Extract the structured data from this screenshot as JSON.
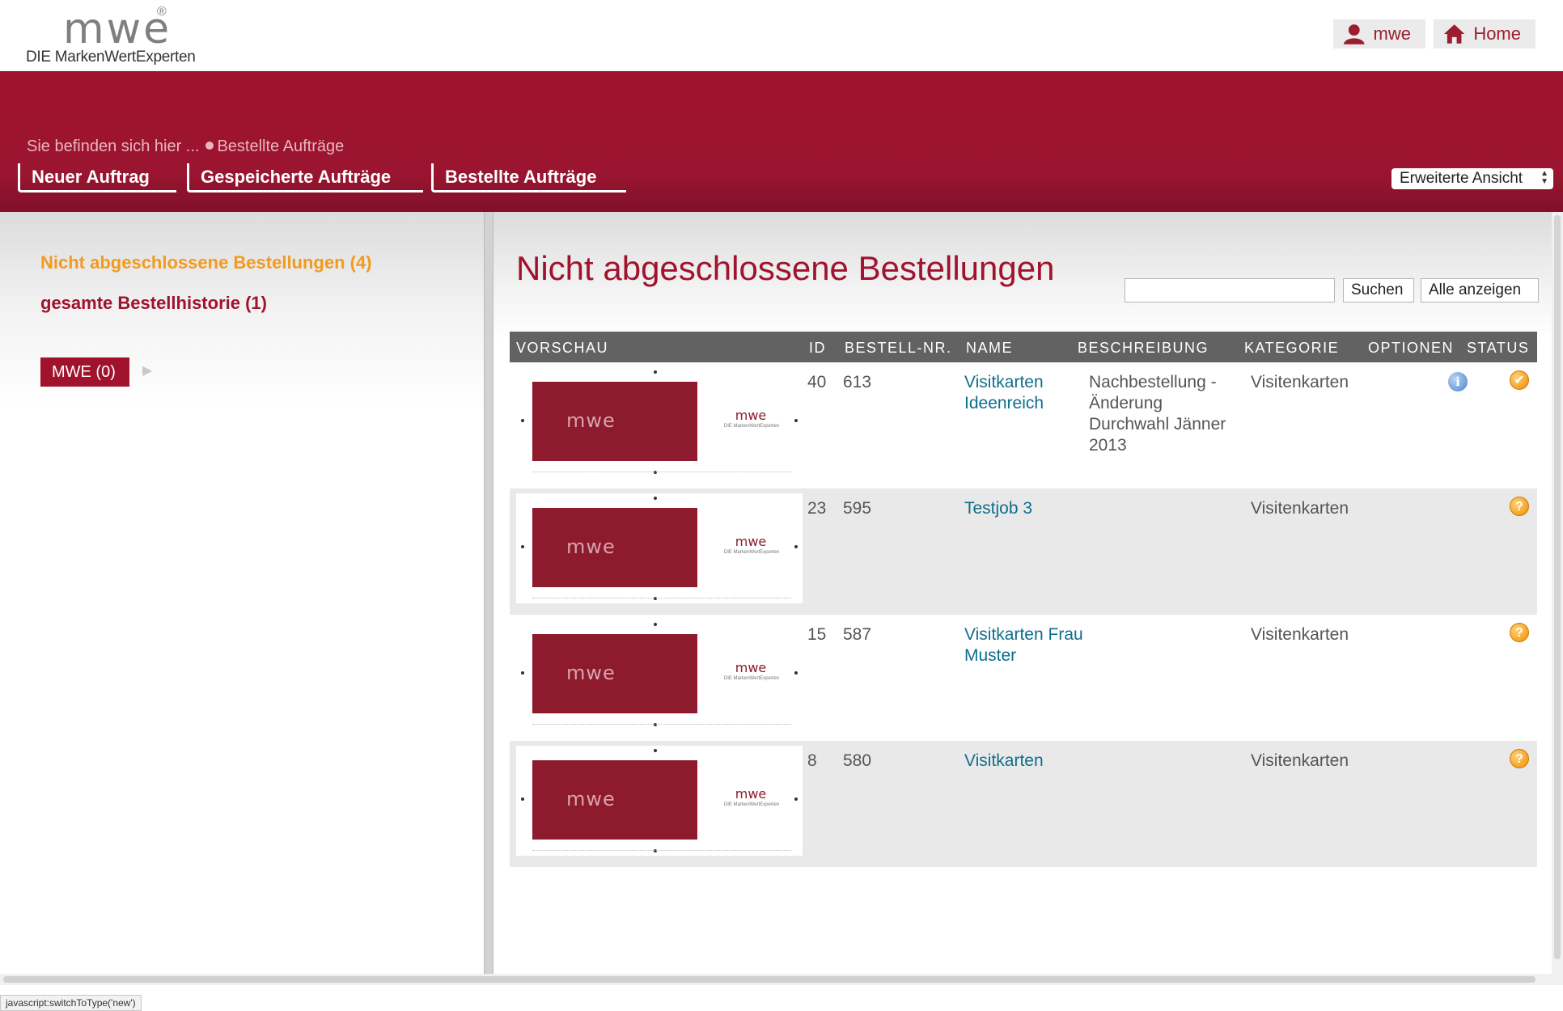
{
  "header": {
    "logo_mark": "mwe",
    "logo_reg": "®",
    "logo_tagline": "DIE MarkenWertExperten",
    "user_label": "mwe",
    "home_label": "Home"
  },
  "breadcrumb": {
    "prefix": "Sie befinden sich hier ...",
    "current": "Bestellte Aufträge"
  },
  "nav": {
    "tabs": [
      {
        "label": "Neuer Auftrag"
      },
      {
        "label": "Gespeicherte Aufträge"
      },
      {
        "label": "Bestellte Aufträge"
      }
    ],
    "view_select": "Erweiterte Ansicht"
  },
  "sidebar": {
    "open_orders": "Nicht abgeschlossene Bestellungen (4)",
    "history": "gesamte Bestellhistorie (1)",
    "chip": "MWE (0)",
    "chip_arrow": "▶"
  },
  "main": {
    "title": "Nicht abgeschlossene Bestellungen",
    "search_placeholder": "",
    "search_button": "Suchen",
    "all_button": "Alle anzeigen",
    "columns": {
      "preview": "VORSCHAU",
      "id": "ID",
      "order_nr": "BESTELL-NR.",
      "name": "NAME",
      "description": "BESCHREIBUNG",
      "category": "KATEGORIE",
      "options": "OPTIONEN",
      "status": "STATUS"
    },
    "rows": [
      {
        "id": "40",
        "order_nr": "613",
        "name": "Visitkarten Ideenreich",
        "description": "Nachbestellung - Änderung Durchwahl Jänner 2013",
        "category": "Visitenkarten",
        "has_info": true,
        "status": "approved",
        "status_glyph": "✔"
      },
      {
        "id": "23",
        "order_nr": "595",
        "name": "Testjob 3",
        "description": "",
        "category": "Visitenkarten",
        "has_info": false,
        "status": "pending",
        "status_glyph": "?"
      },
      {
        "id": "15",
        "order_nr": "587",
        "name": "Visitkarten Frau Muster",
        "description": "",
        "category": "Visitenkarten",
        "has_info": false,
        "status": "pending",
        "status_glyph": "?"
      },
      {
        "id": "8",
        "order_nr": "580",
        "name": "Visitkarten",
        "description": "",
        "category": "Visitenkarten",
        "has_info": false,
        "status": "pending",
        "status_glyph": "?"
      }
    ],
    "info_glyph": "i",
    "thumb_logo": "mwe",
    "thumb_tagline": "DIE MarkenWertExperten"
  },
  "status_bar": "javascript:switchToType('new')",
  "colors": {
    "brand_red": "#a1122d",
    "accent_orange": "#f39a1e",
    "link_teal": "#0f6e8c",
    "table_header": "#626262"
  },
  "icons": {
    "user": "user-icon",
    "home": "home-icon",
    "info": "info-icon",
    "status_approved": "check-circle-icon",
    "status_pending": "question-circle-icon"
  }
}
